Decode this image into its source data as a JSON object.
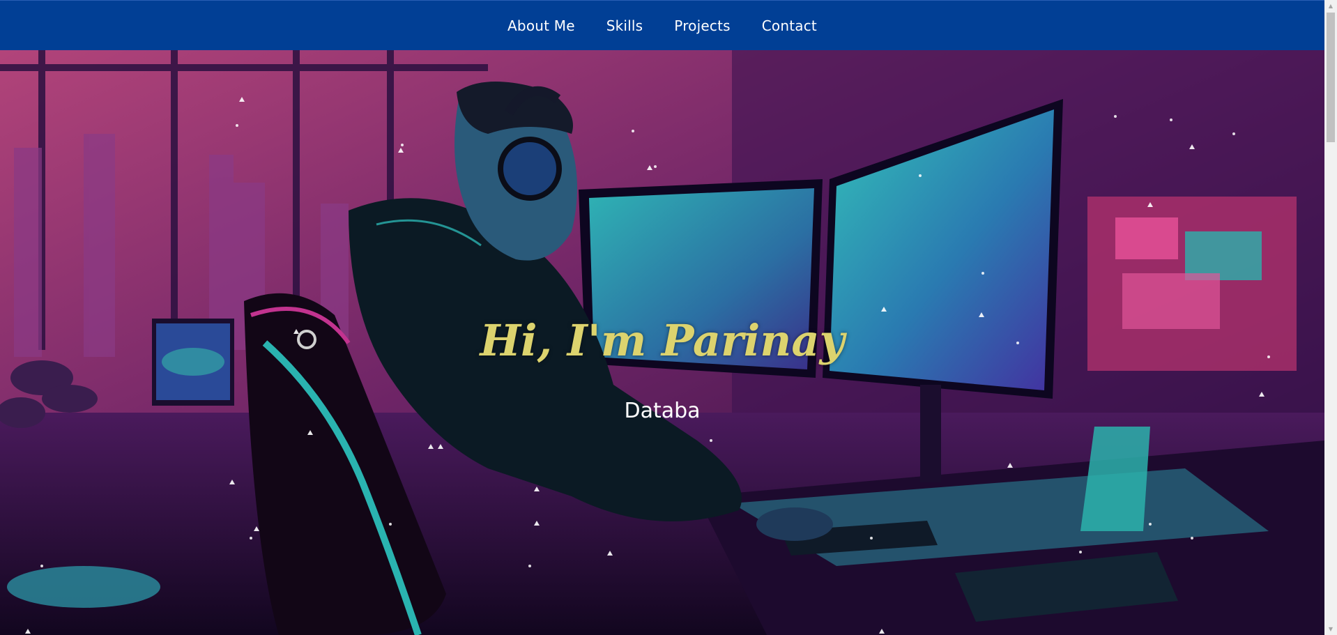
{
  "nav": {
    "items": [
      {
        "label": "About Me"
      },
      {
        "label": "Skills"
      },
      {
        "label": "Projects"
      },
      {
        "label": "Contact"
      }
    ]
  },
  "hero": {
    "greeting": "Hi, I'm Parinay",
    "typed_role": "Databa"
  },
  "colors": {
    "nav_bg": "#013f95",
    "greeting": "#dcd36e",
    "accent_teal": "#2ab3b0",
    "accent_magenta": "#c2338f"
  }
}
